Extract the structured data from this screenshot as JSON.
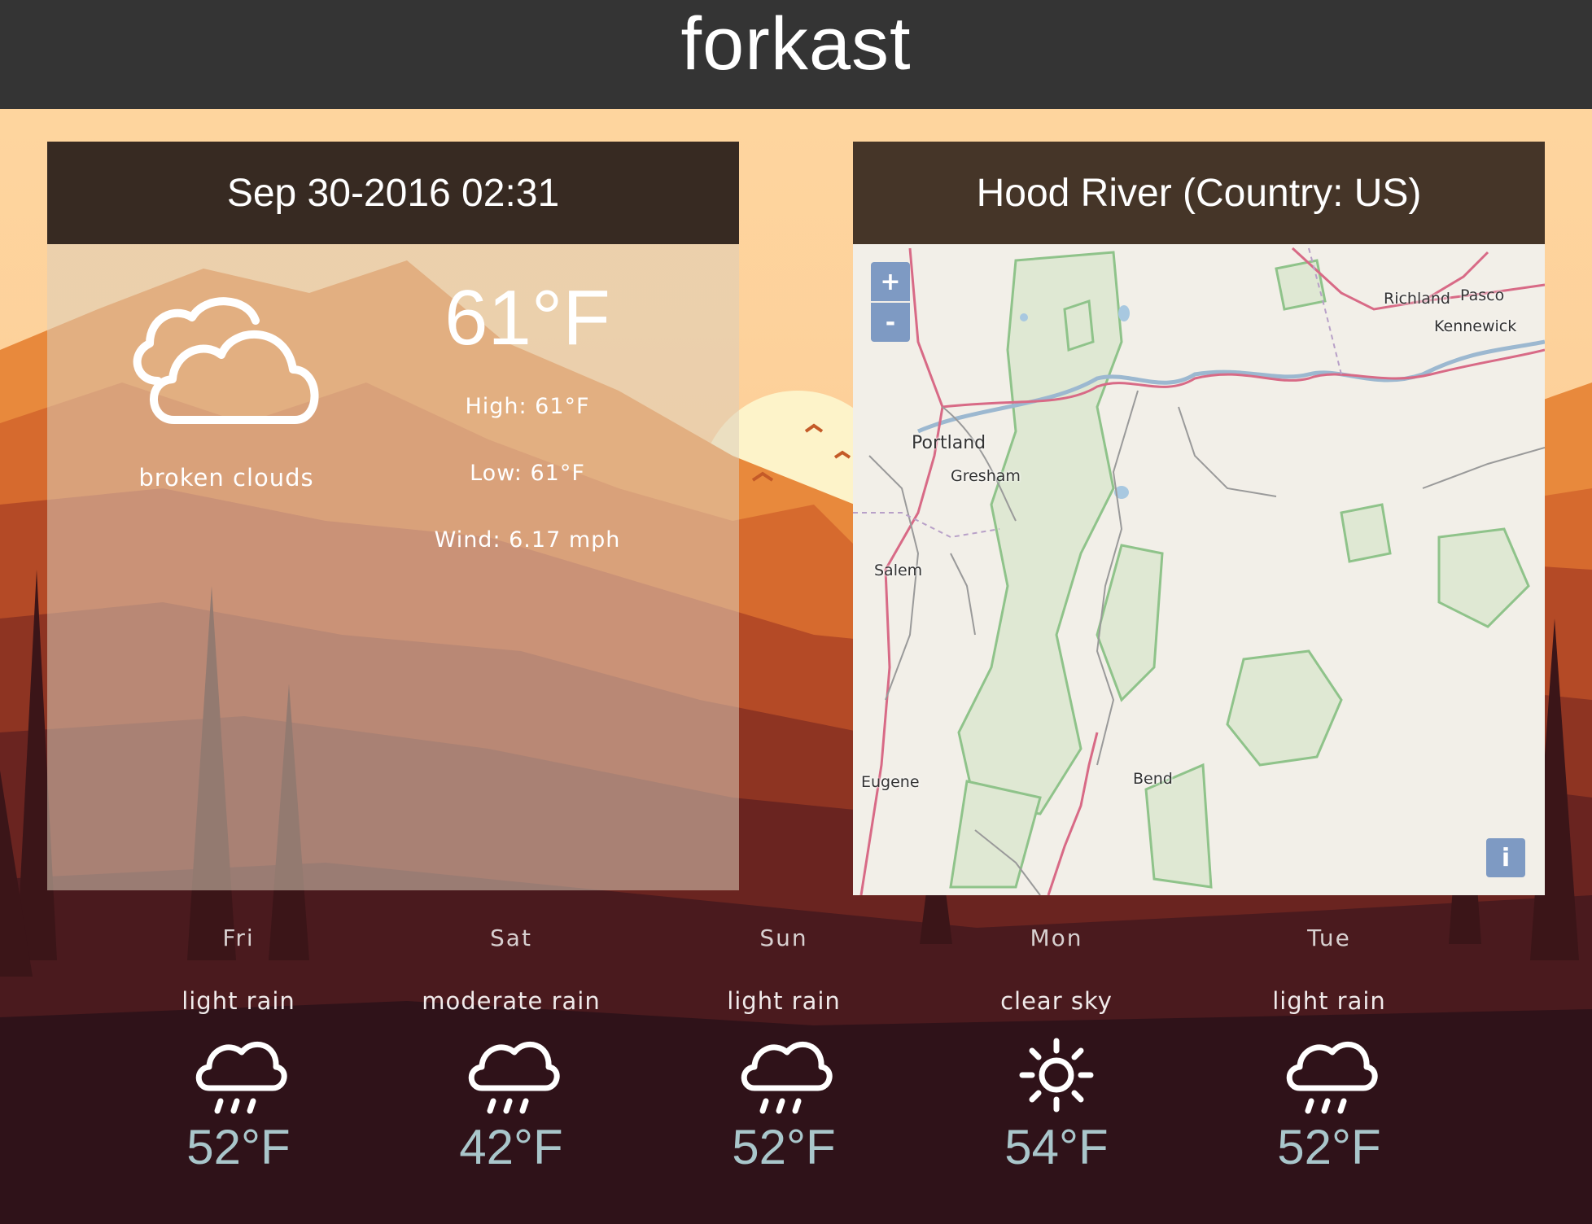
{
  "app": {
    "title": "forkast"
  },
  "current": {
    "datetime": "Sep 30-2016 02:31",
    "icon": "broken-clouds-icon",
    "description": "broken clouds",
    "temperature": "61°F",
    "high": "High: 61°F",
    "low": "Low: 61°F",
    "wind": "Wind: 6.17 mph"
  },
  "location": {
    "title": "Hood River (Country: US)",
    "map": {
      "zoom_in": "+",
      "zoom_out": "-",
      "info": "i",
      "cities": [
        "Portland",
        "Gresham",
        "Salem",
        "Eugene",
        "Bend",
        "Richland",
        "Pasco",
        "Kennewick"
      ]
    }
  },
  "forecast": [
    {
      "day": "Fri",
      "description": "light rain",
      "icon": "rain-icon",
      "temperature": "52°F"
    },
    {
      "day": "Sat",
      "description": "moderate rain",
      "icon": "rain-icon",
      "temperature": "42°F"
    },
    {
      "day": "Sun",
      "description": "light rain",
      "icon": "rain-icon",
      "temperature": "52°F"
    },
    {
      "day": "Mon",
      "description": "clear sky",
      "icon": "sun-icon",
      "temperature": "54°F"
    },
    {
      "day": "Tue",
      "description": "light rain",
      "icon": "rain-icon",
      "temperature": "52°F"
    }
  ],
  "colors": {
    "header_bg": "#343434",
    "panel_head_left": "#372a22",
    "panel_head_right": "#453528",
    "forecast_temp": "#a9c6cb",
    "map_control": "#7e9ac3"
  }
}
